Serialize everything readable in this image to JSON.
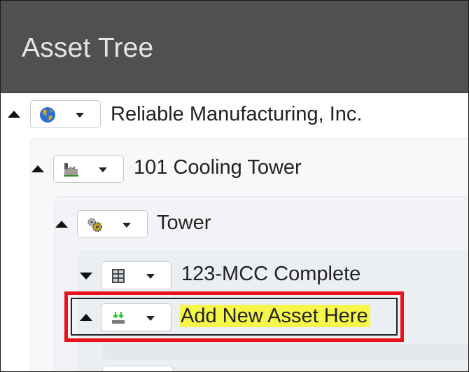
{
  "header": {
    "title": "Asset Tree"
  },
  "tree": {
    "items": [
      {
        "label": "Reliable Manufacturing, Inc.",
        "icon": "globe-icon",
        "toggle": "up"
      },
      {
        "label": "101 Cooling Tower",
        "icon": "factory-icon",
        "toggle": "up"
      },
      {
        "label": "Tower",
        "icon": "gears-icon",
        "toggle": "up"
      },
      {
        "label": "123-MCC Complete",
        "icon": "cabinet-icon",
        "toggle": "down"
      },
      {
        "label": "Add New Asset Here",
        "icon": "add-asset-icon",
        "toggle": "up"
      }
    ]
  },
  "colors": {
    "header_bg": "#505050",
    "highlight_border": "#e8121b",
    "text_highlight": "#f6f64a"
  }
}
